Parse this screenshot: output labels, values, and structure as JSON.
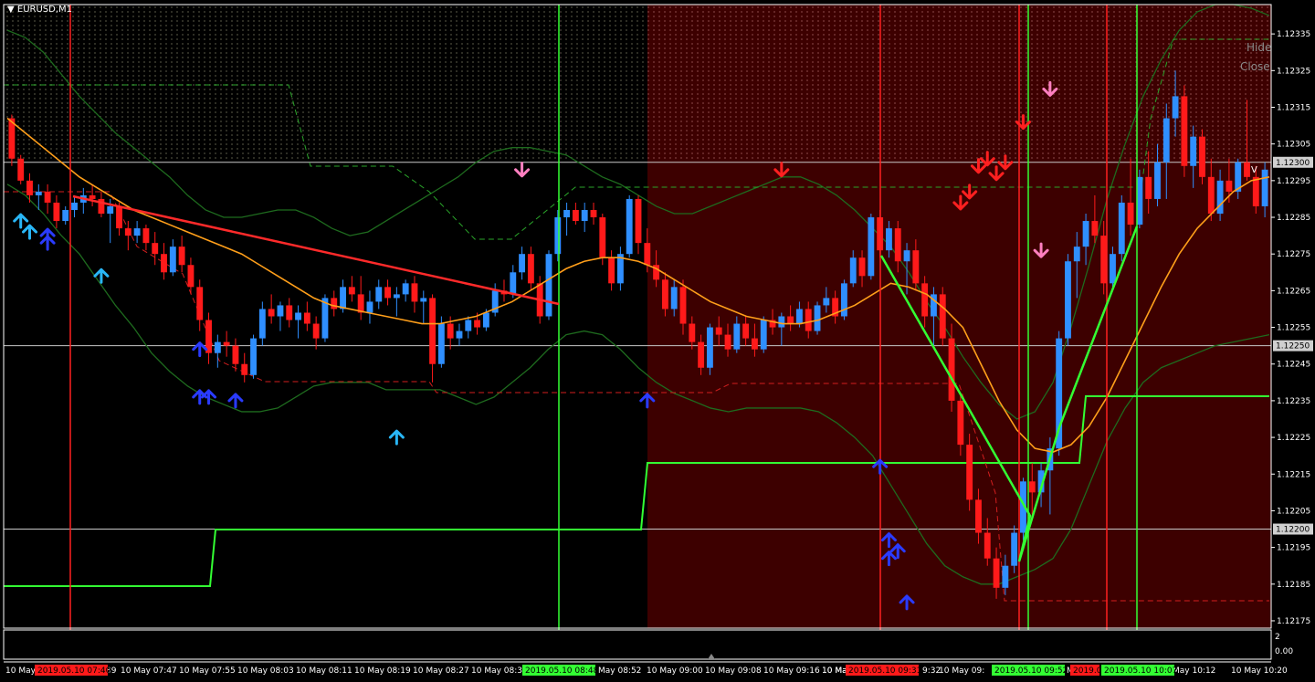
{
  "chart_title": "EURUSD,M1",
  "controls": {
    "hide": "Hide",
    "close": "Close"
  },
  "colors": {
    "background": "#000000",
    "bear_zone": "#3d0000",
    "bull_candle": "#2f8fff",
    "bear_candle": "#ff1a1a",
    "ma_orange": "#ff9f1a",
    "band_green": "#1e6b1e",
    "signal_green": "#33ff33",
    "grid_line": "#c8c8c8",
    "trend_red": "#ff2a2a"
  },
  "price_axis": {
    "labels": [
      "1.12335",
      "1.12325",
      "1.12315",
      "1.12305",
      "1.12295",
      "1.12285",
      "1.12275",
      "1.12265",
      "1.12255",
      "1.12245",
      "1.12235",
      "1.12225",
      "1.12215",
      "1.12205",
      "1.12195",
      "1.12185",
      "1.12175"
    ],
    "highlighted": [
      "1.12300",
      "1.12250",
      "1.12200"
    ],
    "badge_marker": "V"
  },
  "indicator_axis": {
    "labels": [
      "2",
      "0.00"
    ]
  },
  "time_axis": {
    "labels": [
      "10 May",
      "39",
      "10 May 07:47",
      "10 May 07:55",
      "10 May 08:03",
      "10 May 08:11",
      "10 May 08:19",
      "10 May 08:27",
      "10 May 08:35",
      "May 08:52",
      "10 May 09:00",
      "10 May 09:08",
      "10 May 09:16",
      "10 May 09:24",
      "10 Ma",
      "9:32",
      "10 May 09:",
      "M",
      "May 10:12",
      "10 May 10:20"
    ],
    "markers": [
      {
        "text": "2019.05.10 07:40",
        "color": "red"
      },
      {
        "text": "2019.05.10 08:48",
        "color": "green"
      },
      {
        "text": "2019.05.10 09:31",
        "color": "red"
      },
      {
        "text": "2019.05.10 09:52",
        "color": "green"
      },
      {
        "text": "2019.0",
        "color": "red"
      },
      {
        "text": "2019.05.10 10:07",
        "color": "green"
      }
    ]
  },
  "chart_data": {
    "type": "candlestick",
    "symbol": "EURUSD",
    "timeframe": "M1",
    "ylim": [
      1.12173,
      1.12343
    ],
    "horizontal_levels": [
      1.123,
      1.1225,
      1.122
    ],
    "candles": [
      [
        1.12312,
        1.12313,
        1.12299,
        1.12301
      ],
      [
        1.12301,
        1.12302,
        1.12294,
        1.12295
      ],
      [
        1.12295,
        1.12297,
        1.12289,
        1.12291
      ],
      [
        1.12291,
        1.12294,
        1.12287,
        1.12292
      ],
      [
        1.12292,
        1.12294,
        1.12286,
        1.12289
      ],
      [
        1.12289,
        1.12291,
        1.12282,
        1.12284
      ],
      [
        1.12284,
        1.12288,
        1.12283,
        1.12287
      ],
      [
        1.12287,
        1.12291,
        1.12285,
        1.12289
      ],
      [
        1.12289,
        1.12293,
        1.12286,
        1.12291
      ],
      [
        1.12291,
        1.12294,
        1.12288,
        1.1229
      ],
      [
        1.1229,
        1.12292,
        1.12285,
        1.12286
      ],
      [
        1.12286,
        1.1229,
        1.12278,
        1.12288
      ],
      [
        1.12288,
        1.12289,
        1.1228,
        1.12282
      ],
      [
        1.12282,
        1.12284,
        1.12276,
        1.1228
      ],
      [
        1.1228,
        1.12284,
        1.12278,
        1.12282
      ],
      [
        1.12282,
        1.12283,
        1.12276,
        1.12278
      ],
      [
        1.12278,
        1.12281,
        1.12272,
        1.12275
      ],
      [
        1.12275,
        1.12278,
        1.12268,
        1.1227
      ],
      [
        1.1227,
        1.12279,
        1.12269,
        1.12277
      ],
      [
        1.12277,
        1.1228,
        1.1227,
        1.12272
      ],
      [
        1.12272,
        1.12274,
        1.12264,
        1.12266
      ],
      [
        1.12266,
        1.12268,
        1.12254,
        1.12257
      ],
      [
        1.12257,
        1.12259,
        1.12245,
        1.12248
      ],
      [
        1.12248,
        1.12253,
        1.12244,
        1.12251
      ],
      [
        1.12251,
        1.12254,
        1.12247,
        1.1225
      ],
      [
        1.1225,
        1.12252,
        1.12243,
        1.12245
      ],
      [
        1.12245,
        1.12248,
        1.1224,
        1.12242
      ],
      [
        1.12242,
        1.12253,
        1.12241,
        1.12252
      ],
      [
        1.12252,
        1.12262,
        1.1225,
        1.1226
      ],
      [
        1.1226,
        1.12264,
        1.12256,
        1.12258
      ],
      [
        1.12258,
        1.12262,
        1.12254,
        1.12261
      ],
      [
        1.12261,
        1.12263,
        1.12255,
        1.12257
      ],
      [
        1.12257,
        1.12261,
        1.12252,
        1.12259
      ],
      [
        1.12259,
        1.12262,
        1.12254,
        1.12256
      ],
      [
        1.12256,
        1.12258,
        1.12249,
        1.12252
      ],
      [
        1.12252,
        1.12264,
        1.12251,
        1.12263
      ],
      [
        1.12263,
        1.12265,
        1.12258,
        1.1226
      ],
      [
        1.1226,
        1.12268,
        1.12259,
        1.12266
      ],
      [
        1.12266,
        1.12269,
        1.12262,
        1.12264
      ],
      [
        1.12264,
        1.12269,
        1.12257,
        1.12259
      ],
      [
        1.12259,
        1.12265,
        1.12256,
        1.12262
      ],
      [
        1.12262,
        1.12268,
        1.1226,
        1.12266
      ],
      [
        1.12266,
        1.12268,
        1.12261,
        1.12263
      ],
      [
        1.12263,
        1.12266,
        1.12258,
        1.12264
      ],
      [
        1.12264,
        1.12268,
        1.12262,
        1.12267
      ],
      [
        1.12267,
        1.12269,
        1.12259,
        1.12262
      ],
      [
        1.12262,
        1.12265,
        1.12256,
        1.12263
      ],
      [
        1.12263,
        1.12264,
        1.1224,
        1.12245
      ],
      [
        1.12245,
        1.12258,
        1.12244,
        1.12256
      ],
      [
        1.12256,
        1.12258,
        1.12249,
        1.12252
      ],
      [
        1.12252,
        1.12256,
        1.1225,
        1.12254
      ],
      [
        1.12254,
        1.12258,
        1.12252,
        1.12257
      ],
      [
        1.12257,
        1.12259,
        1.12253,
        1.12255
      ],
      [
        1.12255,
        1.1226,
        1.12254,
        1.12259
      ],
      [
        1.12259,
        1.12267,
        1.12258,
        1.12265
      ],
      [
        1.12265,
        1.12268,
        1.12262,
        1.12264
      ],
      [
        1.12264,
        1.12272,
        1.12263,
        1.1227
      ],
      [
        1.1227,
        1.12277,
        1.12268,
        1.12275
      ],
      [
        1.12275,
        1.12277,
        1.12265,
        1.12267
      ],
      [
        1.12267,
        1.12269,
        1.12256,
        1.12258
      ],
      [
        1.12258,
        1.12276,
        1.12257,
        1.12275
      ],
      [
        1.12275,
        1.12287,
        1.12273,
        1.12285
      ],
      [
        1.12285,
        1.12289,
        1.1228,
        1.12287
      ],
      [
        1.12287,
        1.12289,
        1.12283,
        1.12284
      ],
      [
        1.12284,
        1.12289,
        1.12281,
        1.12287
      ],
      [
        1.12287,
        1.12289,
        1.12283,
        1.12285
      ],
      [
        1.12285,
        1.12286,
        1.12272,
        1.12274
      ],
      [
        1.12274,
        1.12276,
        1.12265,
        1.12267
      ],
      [
        1.12267,
        1.12277,
        1.12265,
        1.12275
      ],
      [
        1.12275,
        1.12291,
        1.12274,
        1.1229
      ],
      [
        1.1229,
        1.12291,
        1.12275,
        1.12278
      ],
      [
        1.12278,
        1.12282,
        1.1227,
        1.12272
      ],
      [
        1.12272,
        1.12276,
        1.12266,
        1.12268
      ],
      [
        1.12268,
        1.1227,
        1.12258,
        1.1226
      ],
      [
        1.1226,
        1.12268,
        1.12258,
        1.12266
      ],
      [
        1.12266,
        1.12268,
        1.12253,
        1.12256
      ],
      [
        1.12256,
        1.12258,
        1.12249,
        1.12251
      ],
      [
        1.12251,
        1.12253,
        1.12242,
        1.12244
      ],
      [
        1.12244,
        1.12256,
        1.12242,
        1.12255
      ],
      [
        1.12255,
        1.12258,
        1.1225,
        1.12253
      ],
      [
        1.12253,
        1.12256,
        1.12247,
        1.12249
      ],
      [
        1.12249,
        1.12258,
        1.12248,
        1.12256
      ],
      [
        1.12256,
        1.12258,
        1.1225,
        1.12252
      ],
      [
        1.12252,
        1.12256,
        1.12247,
        1.12249
      ],
      [
        1.12249,
        1.12258,
        1.12248,
        1.12257
      ],
      [
        1.12257,
        1.1226,
        1.12253,
        1.12255
      ],
      [
        1.12255,
        1.12259,
        1.1225,
        1.12258
      ],
      [
        1.12258,
        1.12261,
        1.12254,
        1.12256
      ],
      [
        1.12256,
        1.12262,
        1.12255,
        1.1226
      ],
      [
        1.1226,
        1.12262,
        1.12252,
        1.12254
      ],
      [
        1.12254,
        1.12262,
        1.12253,
        1.12261
      ],
      [
        1.12261,
        1.12266,
        1.12259,
        1.12263
      ],
      [
        1.12263,
        1.12265,
        1.12256,
        1.12258
      ],
      [
        1.12258,
        1.12268,
        1.12257,
        1.12267
      ],
      [
        1.12267,
        1.12276,
        1.12266,
        1.12274
      ],
      [
        1.12274,
        1.12276,
        1.12266,
        1.12269
      ],
      [
        1.12269,
        1.12286,
        1.12268,
        1.12285
      ],
      [
        1.12285,
        1.12287,
        1.12274,
        1.12276
      ],
      [
        1.12276,
        1.12284,
        1.12274,
        1.12282
      ],
      [
        1.12282,
        1.12284,
        1.1227,
        1.12273
      ],
      [
        1.12273,
        1.12278,
        1.12264,
        1.12276
      ],
      [
        1.12276,
        1.12279,
        1.12265,
        1.12267
      ],
      [
        1.12267,
        1.12269,
        1.12255,
        1.12258
      ],
      [
        1.12258,
        1.12266,
        1.1225,
        1.12264
      ],
      [
        1.12264,
        1.12266,
        1.1225,
        1.12252
      ],
      [
        1.12252,
        1.12256,
        1.12232,
        1.12235
      ],
      [
        1.12235,
        1.12237,
        1.1222,
        1.12223
      ],
      [
        1.12223,
        1.12226,
        1.12205,
        1.12208
      ],
      [
        1.12208,
        1.12211,
        1.12196,
        1.12199
      ],
      [
        1.12199,
        1.12203,
        1.1219,
        1.12192
      ],
      [
        1.12192,
        1.12195,
        1.12181,
        1.12184
      ],
      [
        1.12184,
        1.12193,
        1.12182,
        1.1219
      ],
      [
        1.1219,
        1.12201,
        1.12188,
        1.12199
      ],
      [
        1.12199,
        1.12214,
        1.12197,
        1.12213
      ],
      [
        1.12213,
        1.12218,
        1.12204,
        1.1221
      ],
      [
        1.1221,
        1.12218,
        1.12206,
        1.12216
      ],
      [
        1.12216,
        1.12225,
        1.12204,
        1.12222
      ],
      [
        1.12222,
        1.12254,
        1.1222,
        1.12252
      ],
      [
        1.12252,
        1.12275,
        1.1225,
        1.12273
      ],
      [
        1.12273,
        1.12281,
        1.12263,
        1.12277
      ],
      [
        1.12277,
        1.12286,
        1.12272,
        1.12284
      ],
      [
        1.12284,
        1.12291,
        1.12278,
        1.1228
      ],
      [
        1.1228,
        1.12284,
        1.12264,
        1.12267
      ],
      [
        1.12267,
        1.12277,
        1.12266,
        1.12275
      ],
      [
        1.12275,
        1.12291,
        1.12273,
        1.12289
      ],
      [
        1.12289,
        1.12301,
        1.1228,
        1.12283
      ],
      [
        1.12283,
        1.12298,
        1.12282,
        1.12296
      ],
      [
        1.12296,
        1.12303,
        1.12286,
        1.1229
      ],
      [
        1.1229,
        1.12305,
        1.12288,
        1.123
      ],
      [
        1.123,
        1.12316,
        1.1229,
        1.12312
      ],
      [
        1.12312,
        1.12325,
        1.12307,
        1.12318
      ],
      [
        1.12318,
        1.12321,
        1.12296,
        1.12299
      ],
      [
        1.12299,
        1.1231,
        1.12293,
        1.12307
      ],
      [
        1.12307,
        1.12309,
        1.12294,
        1.12296
      ],
      [
        1.12296,
        1.12301,
        1.12284,
        1.12286
      ],
      [
        1.12286,
        1.12298,
        1.12284,
        1.12295
      ],
      [
        1.12295,
        1.12301,
        1.12289,
        1.12292
      ],
      [
        1.12292,
        1.12301,
        1.1229,
        1.123
      ],
      [
        1.123,
        1.12317,
        1.12295,
        1.12296
      ],
      [
        1.12296,
        1.12299,
        1.12286,
        1.12288
      ],
      [
        1.12288,
        1.123,
        1.12285,
        1.12298
      ]
    ],
    "moving_average": [
      1.12312,
      1.12308,
      1.12304,
      1.123,
      1.12296,
      1.12293,
      1.1229,
      1.12287,
      1.12285,
      1.12283,
      1.12281,
      1.12279,
      1.12277,
      1.12275,
      1.12272,
      1.12269,
      1.12266,
      1.12263,
      1.12261,
      1.1226,
      1.12259,
      1.12258,
      1.12257,
      1.12256,
      1.12256,
      1.12257,
      1.12258,
      1.1226,
      1.12262,
      1.12265,
      1.12268,
      1.12271,
      1.12273,
      1.12274,
      1.12274,
      1.12273,
      1.12271,
      1.12268,
      1.12265,
      1.12262,
      1.1226,
      1.12258,
      1.12257,
      1.12256,
      1.12256,
      1.12257,
      1.12259,
      1.12261,
      1.12264,
      1.12267,
      1.12266,
      1.12264,
      1.1226,
      1.12255,
      1.12245,
      1.12235,
      1.12227,
      1.12222,
      1.12221,
      1.12223,
      1.12228,
      1.12236,
      1.12246,
      1.12256,
      1.12266,
      1.12275,
      1.12282,
      1.12287,
      1.12292,
      1.12295,
      1.12296
    ],
    "upper_band": [
      1.12336,
      1.12334,
      1.1233,
      1.12324,
      1.12318,
      1.12313,
      1.12308,
      1.12304,
      1.123,
      1.12296,
      1.12291,
      1.12287,
      1.12285,
      1.12285,
      1.12286,
      1.12287,
      1.12287,
      1.12285,
      1.12282,
      1.1228,
      1.12281,
      1.12284,
      1.12287,
      1.1229,
      1.12293,
      1.12296,
      1.123,
      1.12303,
      1.12304,
      1.12304,
      1.12303,
      1.12302,
      1.12299,
      1.12296,
      1.12294,
      1.12291,
      1.12288,
      1.12286,
      1.12286,
      1.12288,
      1.1229,
      1.12292,
      1.12294,
      1.12296,
      1.12296,
      1.12294,
      1.12291,
      1.12287,
      1.12282,
      1.12277,
      1.1227,
      1.12262,
      1.12255,
      1.12247,
      1.1224,
      1.12234,
      1.1223,
      1.12232,
      1.1224,
      1.12255,
      1.12272,
      1.1229,
      1.12305,
      1.12318,
      1.12328,
      1.12336,
      1.12341,
      1.12343,
      1.12343,
      1.12342,
      1.1234
    ],
    "lower_band": [
      1.12294,
      1.12291,
      1.12286,
      1.1228,
      1.12275,
      1.12268,
      1.12261,
      1.12255,
      1.12248,
      1.12243,
      1.12239,
      1.12236,
      1.12234,
      1.12232,
      1.12232,
      1.12233,
      1.12236,
      1.12239,
      1.1224,
      1.1224,
      1.1224,
      1.12238,
      1.12238,
      1.12238,
      1.12238,
      1.12236,
      1.12234,
      1.12236,
      1.1224,
      1.12244,
      1.12249,
      1.12253,
      1.12254,
      1.12253,
      1.12249,
      1.12244,
      1.1224,
      1.12237,
      1.12235,
      1.12233,
      1.12232,
      1.12233,
      1.12233,
      1.12233,
      1.12233,
      1.12232,
      1.12229,
      1.12225,
      1.1222,
      1.12212,
      1.12204,
      1.12196,
      1.1219,
      1.12187,
      1.12185,
      1.12185,
      1.12187,
      1.12189,
      1.12192,
      1.122,
      1.12212,
      1.12224,
      1.12233,
      1.1224,
      1.12244,
      1.12246,
      1.12248,
      1.1225,
      1.12251,
      1.12252,
      1.12253
    ],
    "signal_stepline": [
      1.12189,
      1.12189,
      1.12189,
      1.12189,
      1.12189,
      1.12189,
      1.12189,
      1.12189,
      1.12189,
      1.12189,
      1.12189,
      1.12189,
      1.12189,
      1.12189,
      1.12189,
      1.12189,
      1.12189,
      1.12189,
      1.12189,
      1.12189,
      1.12189,
      1.12189,
      1.12189,
      1.12189,
      1.12189,
      1.12189,
      1.12189,
      1.12189,
      1.12189,
      1.12189,
      1.12189,
      1.12189,
      1.12189,
      1.12189,
      1.12189,
      1.12189
    ],
    "arrows": {
      "up_light": [
        [
          1,
          1.12284
        ],
        [
          2,
          1.12281
        ],
        [
          10,
          1.12269
        ],
        [
          43,
          1.12225
        ]
      ],
      "up_blue": [
        [
          4,
          1.12278
        ],
        [
          4,
          1.1228
        ],
        [
          21,
          1.12249
        ],
        [
          21,
          1.12236
        ],
        [
          22,
          1.12236
        ],
        [
          25,
          1.12235
        ],
        [
          71,
          1.12235
        ],
        [
          97,
          1.12217
        ],
        [
          98,
          1.12192
        ],
        [
          98,
          1.12197
        ],
        [
          99,
          1.12194
        ],
        [
          100,
          1.1218
        ]
      ],
      "down_pink": [
        [
          57,
          1.12298
        ],
        [
          115,
          1.12276
        ],
        [
          116,
          1.1232
        ]
      ],
      "down_red": [
        [
          86,
          1.12298
        ],
        [
          106,
          1.12289
        ],
        [
          107,
          1.12292
        ],
        [
          108,
          1.12299
        ],
        [
          109,
          1.12301
        ],
        [
          110,
          1.12297
        ],
        [
          111,
          1.123
        ],
        [
          113,
          1.12311
        ]
      ]
    }
  }
}
